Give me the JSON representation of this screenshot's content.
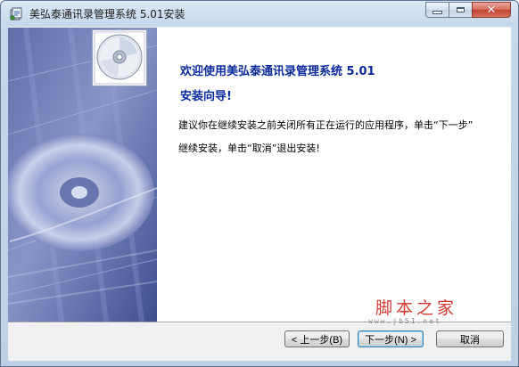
{
  "window": {
    "title": "美弘泰通讯录管理系统 5.01安装",
    "icon": "installer-app-icon"
  },
  "wizard": {
    "heading": "欢迎使用美弘泰通讯录管理系统 5.01",
    "subheading": "安装向导!",
    "body_line1": "建议你在继续安装之前关闭所有正在运行的应用程序，单击“下一步”",
    "body_line2": "继续安装，单击“取消”退出安装!"
  },
  "buttons": {
    "back": "< 上一步(B)",
    "next": "下一步(N) >",
    "cancel": "取消"
  },
  "watermark": {
    "text": "脚本之家",
    "url": "www.jb51.net"
  },
  "colors": {
    "heading": "#0a2a9a",
    "close_button": "#c2412f",
    "watermark": "#d13a30"
  }
}
